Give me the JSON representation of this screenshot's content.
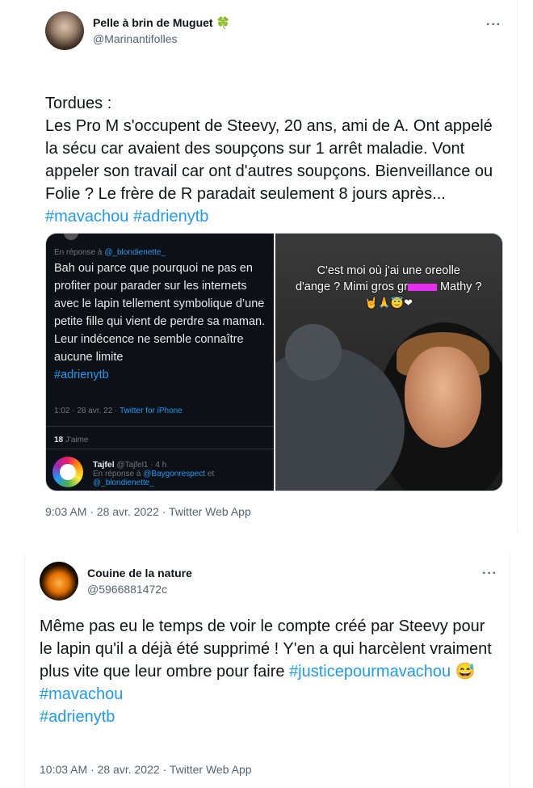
{
  "tweet1": {
    "display_name": "Pelle à brin de Muguet",
    "name_emoji": "🍀",
    "handle": "@Marinantifolles",
    "more": "···",
    "body_text": "Tordues :\nLes Pro M s'occupent de Steevy, 20 ans, ami de A. Ont appelé la sécu car avaient des soupçons sur 1 arrêt maladie. Vont appeler son travail car ont d'autres soupçons. Bienveillance ou Folie ? Le frère de R paradait seulement 8 jours après...",
    "hashtags": [
      "#mavachou",
      "#adrienytb"
    ],
    "timestamp": "9:03 AM · 28 avr. 2022 · Twitter Web App",
    "media": {
      "left": {
        "reply_prefix": "En réponse à ",
        "reply_handle": "@_blondienette_",
        "text": "Bah oui parce que pourquoi ne pas en profiter pour parader sur les internets avec le lapin tellement symbolique d’une petite fille qui vient de perdre sa maman. Leur indécence ne semble connaître aucune limite",
        "hashtag": "#adrienytb",
        "meta_time": "1:02 · 28 avr. 22 · ",
        "meta_source": "Twitter for iPhone",
        "likes_count": "18",
        "likes_label": "J'aime",
        "reply_user_name": "Tajfel",
        "reply_user_handle": "@Tajfel1 · 4 h",
        "reply_user_prefix": "En réponse à ",
        "reply_user_to1": "@Baygonrespect",
        "reply_user_and": " et",
        "reply_user_to2": "@_blondienette_"
      },
      "right": {
        "caption_line1": "C'est moi où j'ai une oreolle",
        "caption_line2_a": "d'ange ? Mimi gros gr",
        "caption_line2_b": " Mathy ?",
        "caption_emojis": "🤘🙏😇❤"
      }
    }
  },
  "tweet2": {
    "display_name": "Couine de la nature",
    "handle": "@5966881472c",
    "more": "···",
    "body_text": "Même pas eu le temps de voir le compte créé par Steevy pour le lapin qu'il a déjà été supprimé ! Y'en a qui harcèlent vraiment plus vite que leur ombre pour faire ",
    "inline_hashtag": "#justicepourmavachou",
    "inline_emoji": "😅",
    "hashtags": [
      "#mavachou",
      "#adrienytb"
    ],
    "timestamp": "10:03 AM · 28 avr. 2022 · Twitter Web App"
  },
  "colors": {
    "link": "#1d9bf0",
    "secondary": "#536471",
    "text": "#0f1419"
  }
}
